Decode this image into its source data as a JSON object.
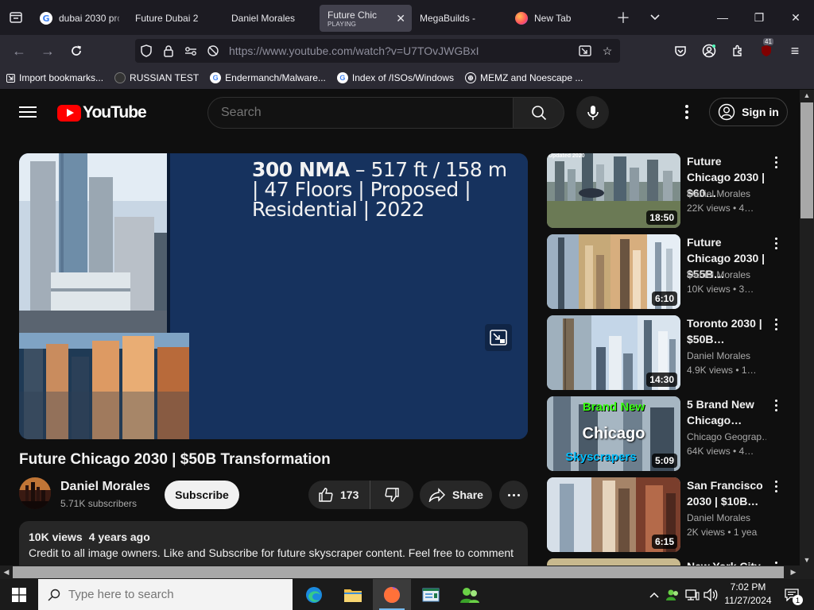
{
  "browser": {
    "tabs": [
      {
        "title": "dubai 2030 pro",
        "icon": "google-icon"
      },
      {
        "title": "Future Dubai 2",
        "icon": "youtube-icon"
      },
      {
        "title": "Daniel Morales",
        "icon": "youtube-icon"
      },
      {
        "title": "Future Chica",
        "subtitle": "PLAYING",
        "icon": "youtube-icon",
        "active": true
      },
      {
        "title": "MegaBuilds -",
        "icon": "youtube-icon"
      },
      {
        "title": "New Tab",
        "icon": "firefox-icon"
      }
    ],
    "url": "https://www.youtube.com/watch?v=U7TOvJWGBxI",
    "extension_badge": "41",
    "bookmarks": [
      {
        "label": "Import bookmarks...",
        "icon": "import-icon"
      },
      {
        "label": "RUSSIAN TEST",
        "icon": "site-icon"
      },
      {
        "label": "Endermanch/Malware...",
        "icon": "google-icon"
      },
      {
        "label": "Index of /ISOs/Windows",
        "icon": "google-icon"
      },
      {
        "label": "MEMZ and Noescape ...",
        "icon": "globe-icon"
      }
    ]
  },
  "youtube": {
    "logo_text": "YouTube",
    "search_placeholder": "Search",
    "sign_in": "Sign in",
    "video": {
      "overlay_bold": "300 NMA",
      "overlay_rest": " – 517 ft / 158 m | 47 Floors | Proposed | Residential | 2022",
      "title": "Future Chicago 2030 | $50B Transformation",
      "channel": "Daniel Morales",
      "subscribers": "5.71K subscribers",
      "subscribe": "Subscribe",
      "likes": "173",
      "share": "Share",
      "views": "10K views",
      "age": "4 years ago",
      "description": "Credit to all image owners. Like and Subscribe for future skyscraper content. Feel free to comment"
    },
    "recommendations": [
      {
        "title": "Future Chicago 2030 | $60…",
        "channel": "Daniel Morales",
        "meta": "22K views • 4…",
        "duration": "18:50",
        "thumb_badge": "Updated 2020"
      },
      {
        "title": "Future Chicago 2030 | $55B…",
        "channel": "Daniel Morales",
        "meta": "10K views • 3…",
        "duration": "6:10"
      },
      {
        "title": "Toronto 2030 | $50B…",
        "channel": "Daniel Morales",
        "meta": "4.9K views • 1…",
        "duration": "14:30"
      },
      {
        "title": "5 Brand New Chicago…",
        "channel": "Chicago Geograp…",
        "meta": "64K views • 4…",
        "duration": "5:09",
        "thumb_text": [
          "Brand New",
          "Chicago",
          "Skyscrapers"
        ]
      },
      {
        "title": "San Francisco 2030 | $10B…",
        "channel": "Daniel Morales",
        "meta": "2K views • 1 yea…",
        "duration": "6:15"
      },
      {
        "title": "New York City",
        "channel": "",
        "meta": "",
        "duration": ""
      }
    ]
  },
  "taskbar": {
    "search_placeholder": "Type here to search",
    "time": "7:02 PM",
    "date": "11/27/2024",
    "notification_count": "1"
  },
  "colors": {
    "youtube_red": "#ff0000",
    "accent": "#76b9ed"
  }
}
